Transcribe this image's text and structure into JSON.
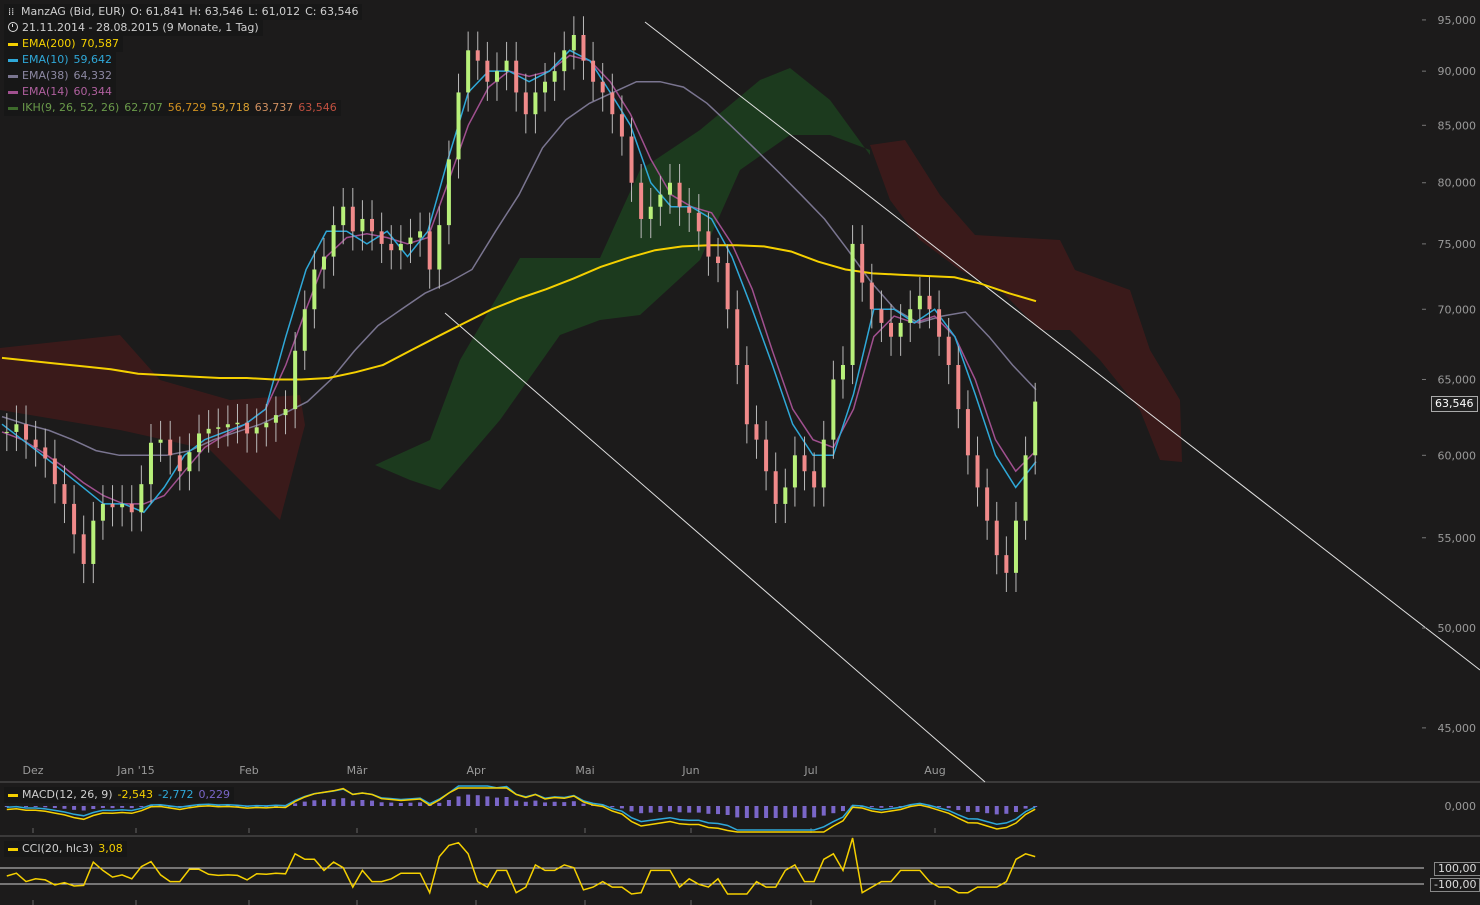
{
  "header": {
    "symbol": "ManzAG (Bid, EUR)",
    "open": "O: 61,841",
    "high": "H: 63,546",
    "low": "L: 61,012",
    "close": "C: 63,546",
    "range": "21.11.2014 - 28.08.2015 (9 Monate, 1 Tag)"
  },
  "legend": [
    {
      "label": "EMA(200)",
      "values": [
        "70,587"
      ],
      "color": "#f5d000",
      "value_colors": [
        "#f5d000"
      ]
    },
    {
      "label": "EMA(10)",
      "values": [
        "59,642"
      ],
      "color": "#2fa8d8",
      "value_colors": [
        "#2fa8d8"
      ]
    },
    {
      "label": "EMA(38)",
      "values": [
        "64,332"
      ],
      "color": "#7a7590",
      "value_colors": [
        "#8d89a3"
      ]
    },
    {
      "label": "EMA(14)",
      "values": [
        "60,344"
      ],
      "color": "#a0508f",
      "value_colors": [
        "#b0609f"
      ]
    },
    {
      "label": "IKH(9, 26, 52, 26)",
      "values": [
        "62,707",
        "56,729",
        "59,718",
        "63,737",
        "63,546"
      ],
      "color": "#3d6a2b",
      "value_colors": [
        "#6a9a4a",
        "#d09020",
        "#d9a030",
        "#d09060",
        "#c05040"
      ]
    }
  ],
  "last_price_tag": "63,546",
  "macd": {
    "label": "MACD(12, 26, 9)",
    "v1": "-2,543",
    "v2": "-2,772",
    "v3": "0,229",
    "zero_label": "0,000"
  },
  "cci": {
    "label": "CCI(20, hlc3)",
    "value": "3,08",
    "upper_label": "100,00",
    "lower_label": "-100,00"
  },
  "chart_data": {
    "type": "candlestick",
    "title": "ManzAG (Bid, EUR)",
    "x_labels": [
      "Dez",
      "Jan '15",
      "Feb",
      "Mär",
      "Apr",
      "Mai",
      "Jun",
      "Jul",
      "Aug"
    ],
    "y_ticks": [
      45000,
      50000,
      55000,
      60000,
      65000,
      70000,
      75000,
      80000,
      85000,
      90000,
      95000
    ],
    "y_tick_labels": [
      "45,000",
      "50,000",
      "55,000",
      "60,000",
      "65,000",
      "70,000",
      "75,000",
      "80,000",
      "85,000",
      "90,000",
      "95,000"
    ],
    "ylim": [
      43500,
      96000
    ],
    "close_series": [
      61.5,
      62,
      61,
      60.5,
      59.8,
      58.2,
      57,
      55.2,
      53.5,
      56,
      57,
      56.8,
      57,
      56.5,
      58.2,
      60.8,
      61,
      60,
      59,
      60.2,
      61.4,
      61.7,
      61.8,
      62,
      62.1,
      61.4,
      61.8,
      62.1,
      62.6,
      63,
      67,
      70,
      73,
      74,
      76.5,
      78,
      76,
      77,
      76,
      75,
      74.5,
      75,
      75.5,
      76,
      73,
      76.5,
      82,
      88,
      92,
      91,
      89,
      90,
      91,
      88,
      86,
      88,
      89,
      90,
      92,
      93.5,
      91,
      89,
      88,
      86,
      84,
      80,
      77,
      78,
      79,
      80,
      78,
      77.5,
      76,
      74,
      73.5,
      70,
      66,
      62,
      61,
      59,
      57,
      58,
      60,
      59,
      58,
      61,
      65,
      66,
      75,
      72,
      70,
      69,
      68,
      69,
      70,
      71,
      70,
      68,
      66,
      63,
      60,
      58,
      56,
      54,
      53,
      56,
      60,
      63.5
    ],
    "ema200": [
      66.5,
      66.3,
      66.1,
      65.9,
      65.7,
      65.4,
      65.3,
      65.2,
      65.1,
      65.1,
      65,
      65,
      65.1,
      65.5,
      66,
      67,
      68,
      69,
      70,
      70.8,
      71.5,
      72.3,
      73.2,
      73.9,
      74.5,
      74.8,
      74.9,
      74.9,
      74.8,
      74.4,
      73.6,
      73,
      72.7,
      72.6,
      72.5,
      72.4,
      71.9,
      71.2,
      70.6
    ],
    "ema10": [
      62,
      61,
      60,
      59,
      58,
      57,
      57,
      56.5,
      58,
      60,
      61,
      61.5,
      62,
      63,
      68,
      73,
      76,
      76,
      75,
      76,
      74,
      76,
      82,
      88,
      90,
      90,
      89,
      90,
      92,
      91,
      88,
      85,
      80,
      78,
      78,
      77,
      74,
      70,
      66,
      62,
      60,
      60,
      64,
      70,
      70,
      69,
      70,
      68,
      64,
      60,
      58,
      59.6
    ],
    "ema38": [
      62.5,
      62,
      61.6,
      61,
      60.3,
      60,
      60,
      60,
      60.3,
      61,
      61.5,
      62,
      62.7,
      63.5,
      65,
      67,
      68.8,
      70,
      71.2,
      72,
      73,
      76,
      79,
      83,
      85.5,
      87,
      88,
      89,
      89,
      88.5,
      87,
      85,
      83,
      81,
      79,
      77,
      74.5,
      72,
      70,
      69,
      69.5,
      69.8,
      68,
      66,
      64.3
    ],
    "ema14": [
      61.5,
      61,
      60.2,
      59.3,
      58.3,
      57.5,
      57,
      57,
      57.5,
      59,
      60.5,
      61.3,
      62,
      63,
      66,
      70,
      74,
      75.5,
      75.8,
      75.5,
      75,
      75.5,
      80,
      85,
      88.5,
      90,
      89.5,
      90,
      91.5,
      91,
      89,
      86,
      82,
      79,
      78,
      77.5,
      75,
      71.5,
      67,
      63,
      61,
      60.5,
      63,
      68,
      69.5,
      69,
      69.5,
      68,
      65,
      61,
      59,
      60.3
    ],
    "macd_label": "MACD(12, 26, 9)",
    "cci_label": "CCI(20, hlc3)",
    "colors": {
      "up": "#b8f07a",
      "down": "#f08a8a",
      "ema200": "#f5d000",
      "ema10": "#2fa8d8",
      "ema38": "#7a7590",
      "ema14": "#a0508f",
      "cloud_bull": "#1c3a1e",
      "cloud_bear": "#3a1a1a",
      "macd_hist": "#7a66c8",
      "cci_line": "#f5d000"
    }
  }
}
